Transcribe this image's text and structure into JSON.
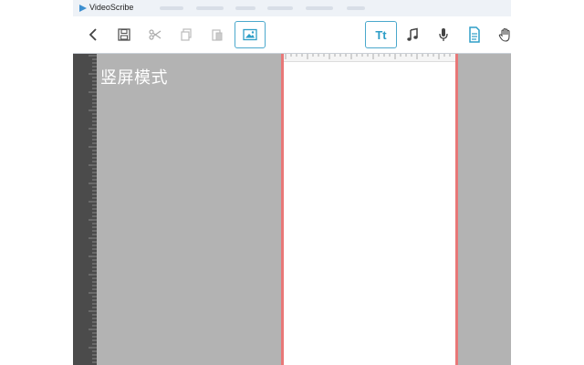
{
  "window": {
    "title": "VideoScribe"
  },
  "toolbar": {
    "left_buttons": [
      {
        "name": "back-button",
        "icon": "chevron-left-icon"
      },
      {
        "name": "save-button",
        "icon": "floppy-disk-icon"
      },
      {
        "name": "cut-button",
        "icon": "scissors-icon"
      },
      {
        "name": "copy-button",
        "icon": "copy-icon"
      },
      {
        "name": "paste-button",
        "icon": "paste-icon"
      },
      {
        "name": "add-image-button",
        "icon": "image-icon",
        "selected": true
      }
    ],
    "right_buttons": [
      {
        "name": "add-text-button",
        "label": "Tt",
        "selected": true
      },
      {
        "name": "music-button",
        "icon": "music-note-icon"
      },
      {
        "name": "voiceover-button",
        "icon": "microphone-icon"
      },
      {
        "name": "document-button",
        "icon": "document-icon"
      },
      {
        "name": "hand-button",
        "icon": "hand-icon"
      }
    ]
  },
  "canvas": {
    "caption": "竖屏模式"
  },
  "colors": {
    "accent": "#2e9ec7",
    "workspace": "#b3b3b3",
    "canvas_border": "#e87878",
    "ruler": "#4b4b4b"
  }
}
